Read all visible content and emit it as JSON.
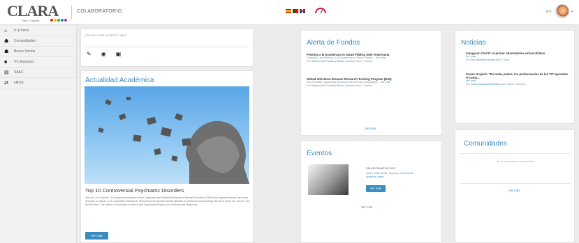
{
  "header": {
    "logo_text": "CLARA",
    "logo_tagline": "Red • Ciencia",
    "title": "COLABORATORIO",
    "user_label": "Em",
    "avatar": "user-avatar",
    "colors": {
      "accent": "#3a8bbf",
      "logo_dots": [
        "#c0392b",
        "#f1c40f",
        "#27ae60",
        "#2980b9",
        "#8e44ad"
      ]
    }
  },
  "sidebar": {
    "items": [
      {
        "label": "Ir al Inicio",
        "icon": "home-icon"
      },
      {
        "label": "Comunidades",
        "icon": "users-icon"
      },
      {
        "label": "Busco Socios",
        "icon": "people-icon"
      },
      {
        "label": "VC Espacios",
        "icon": "video-icon"
      },
      {
        "label": "SAAC",
        "icon": "document-icon"
      },
      {
        "label": "eROS",
        "icon": "exchange-icon"
      }
    ]
  },
  "post": {
    "placeholder": "¿Desea usted compartir algo?"
  },
  "academica": {
    "title": "Actualidad Académica",
    "article_title": "Top 10 Controversial Psychiatric Disorders",
    "article_text": "Source: Live Science | The proposed revisions of the Diagnostic and Statistical Manual of Mental Disorders (DSM) have sparked debate over what illnesses to include in the psychiatric handbook. Everything from gender identity disorder to childhood mood swings has come under fire, and it's not the first time. The history of psychiatry is littered with impassioned fights over controversial diagnoses.",
    "button": "Ver más"
  },
  "fondos": {
    "title": "Alerta de Fondos",
    "items": [
      {
        "title": "Premios a la Excelencia en Salud Pública Inter-Americana",
        "desc": "Cada año, los Premios a la Excelencia en Salud Pública...",
        "link": "Ver más",
        "by": "Por",
        "author": "Sistema de Fondos y Busco Socios",
        "time": "| Hace 7 meses"
      },
      {
        "title": "Global Infectious Disease Research Training Program (D43)",
        "desc": "This Funding Opportunity Announcement (FOA) encourages...",
        "link": "Ver más",
        "by": "Por",
        "author": "Sistema de Fondos y Busco Socios",
        "time": "| Hace 7 meses"
      }
    ],
    "more": "Ver más"
  },
  "eventos": {
    "title": "Eventos",
    "event_title": "DÍA INFORMATIVO DDC",
    "event_dates": "Inicio: 2015-06-24, Termina: 2015-06-24",
    "event_place": "América Latina",
    "button": "Ver más",
    "more": "Ver más"
  },
  "noticias": {
    "title": "Noticias",
    "items": [
      {
        "title": "Inauguran CloVO: el primer observatorio virtual chileno",
        "link": "Ver más",
        "by": "Por",
        "author": "luis.cassel@redclara.net",
        "time": "| 7 días"
      },
      {
        "title": "Susan Grajeck: \"En todas partes, los profesionales de las TIC aprenden el comp...",
        "link": "Ver más",
        "by": "Por",
        "author": "maria.pracique@redclara.net",
        "time": "| Hace 1 semana"
      }
    ]
  },
  "comunidades": {
    "title": "Comunidades",
    "empty_text": "No se encontraron comunidades",
    "more": "Ver más"
  }
}
